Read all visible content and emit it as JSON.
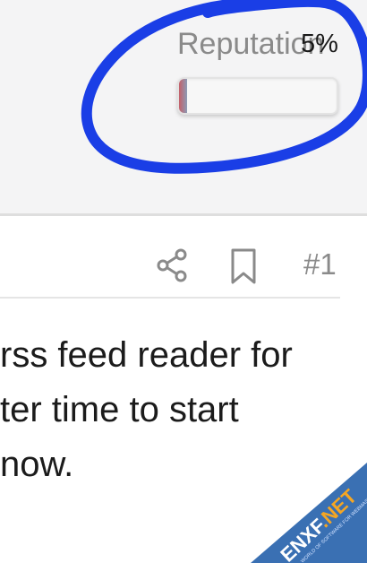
{
  "reputation": {
    "label": "Reputation",
    "percent_text": "5%",
    "fill_fraction": 0.05
  },
  "annotation": {
    "color": "#1a3ee6"
  },
  "post_actions": {
    "share_icon": "share-icon",
    "bookmark_icon": "bookmark-icon",
    "post_number": "#1"
  },
  "post": {
    "lines": [
      " rss feed reader for",
      "ter time to start",
      "now."
    ]
  },
  "watermark": {
    "text": "ENXF.NET",
    "subtext": "WORLD OF SOFTWARE FOR WEBMASTERS"
  }
}
